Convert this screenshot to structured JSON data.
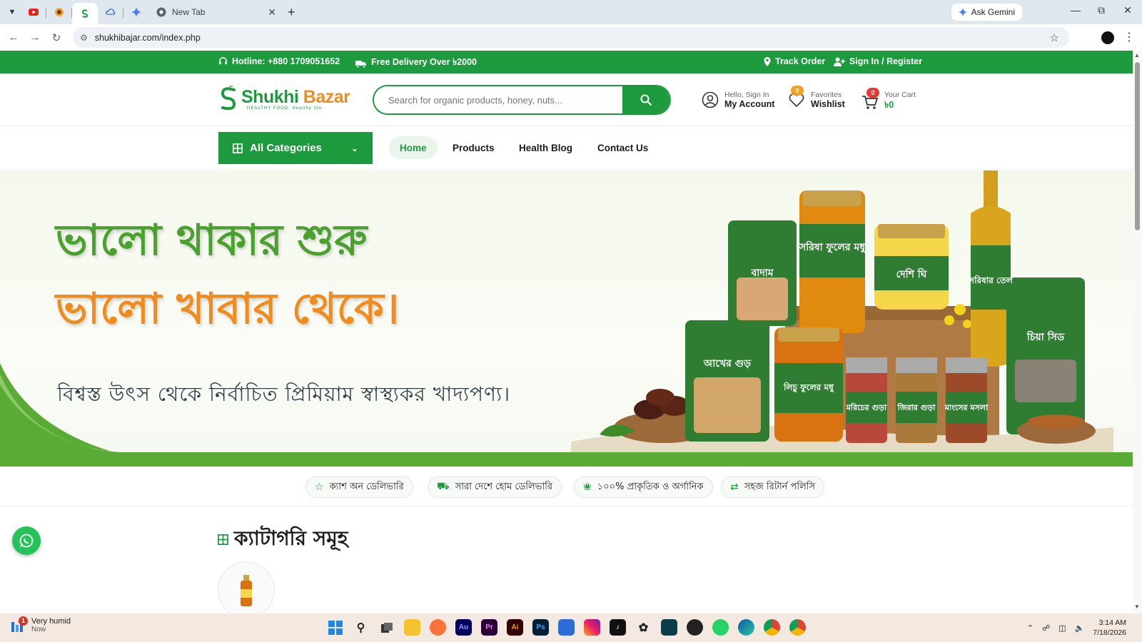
{
  "browser": {
    "tabs": [
      {
        "name": "youtube-tab"
      },
      {
        "name": "tab-2"
      },
      {
        "name": "shukhi-bazar-tab",
        "active": true
      },
      {
        "name": "tab-4"
      },
      {
        "name": "gemini-tab"
      },
      {
        "title": "New Tab"
      }
    ],
    "ask_gemini": "Ask Gemini",
    "url": "shukhibajar.com/index.php"
  },
  "topbar": {
    "hotline": "Hotline: +880 1709051652",
    "delivery": "Free Delivery Over ৳2000",
    "track": "Track Order",
    "signin": "Sign In / Register"
  },
  "header": {
    "logo_name": "Shukhi",
    "logo_name2": "Bazar",
    "logo_tagline": "HEALTHY FOOD. Healthy life.",
    "search_placeholder": "Search for organic products, honey, nuts...",
    "account_small": "Hello, Sign In",
    "account_big": "My Account",
    "wishlist_count": "0",
    "wishlist_small": "Favorites",
    "wishlist_big": "Wishlist",
    "cart_count": "0",
    "cart_small": "Your Cart",
    "cart_big": "৳0"
  },
  "nav": {
    "all_categories": "All Categories",
    "links": [
      "Home",
      "Products",
      "Health Blog",
      "Contact Us"
    ]
  },
  "hero": {
    "line1": "ভালো থাকার শুরু",
    "line2": "ভালো খাবার থেকে।",
    "line3": "বিশ্বস্ত উৎস থেকে নির্বাচিত প্রিমিয়াম স্বাস্থ্যকর খাদ্যপণ্য।",
    "product_labels": [
      "বাদাম",
      "সরিষা ফুলের মধু",
      "দেশি ঘি",
      "সরিষার তেল",
      "আখের গুড়",
      "লিচু ফুলের মধু",
      "মরিচের গুড়া",
      "জিরার গুড়া",
      "মাংসের মসলা",
      "চিয়া সিড"
    ]
  },
  "features": [
    "ক্যাশ অন ডেলিভারি",
    "সারা দেশে হোম ডেলিভারি",
    "১০০% প্রাকৃতিক ও অর্গানিক",
    "সহজ রিটার্ন পলিসি"
  ],
  "categories": {
    "title": "ক্যাটাগরি সমূহ"
  },
  "taskbar": {
    "weather_title": "Very humid",
    "weather_sub": "Now",
    "weather_badge": "1",
    "time": "3:14 AM",
    "date": "7/18/2026"
  },
  "colors": {
    "brand_green": "#1e9a3e",
    "brand_orange": "#f08c1e"
  }
}
